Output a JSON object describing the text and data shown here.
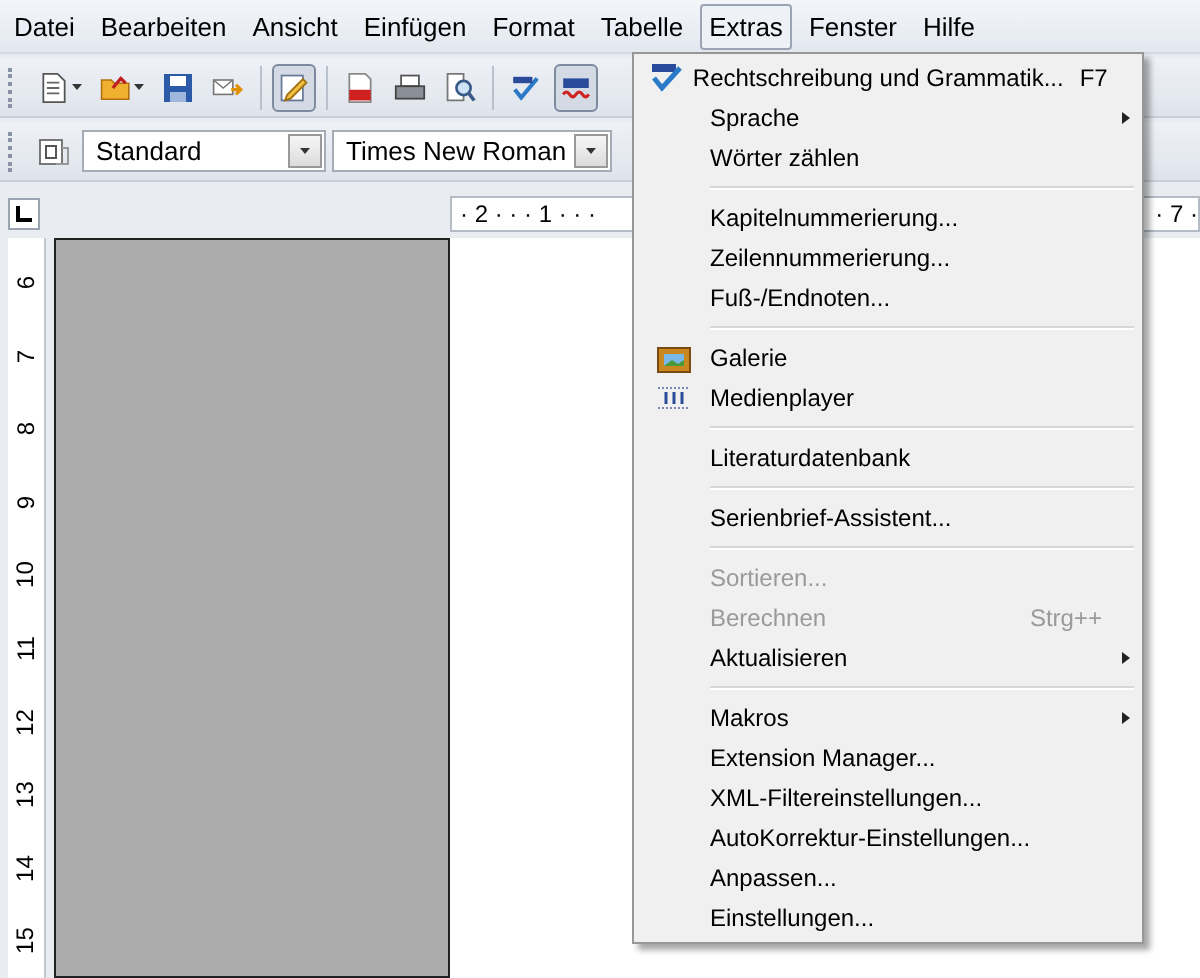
{
  "menubar": [
    {
      "label": "Datei",
      "selected": false
    },
    {
      "label": "Bearbeiten",
      "selected": false
    },
    {
      "label": "Ansicht",
      "selected": false
    },
    {
      "label": "Einfügen",
      "selected": false
    },
    {
      "label": "Format",
      "selected": false
    },
    {
      "label": "Tabelle",
      "selected": false
    },
    {
      "label": "Extras",
      "selected": true
    },
    {
      "label": "Fenster",
      "selected": false
    },
    {
      "label": "Hilfe",
      "selected": false
    }
  ],
  "standard_toolbar": [
    {
      "kind": "new",
      "dropdown": true,
      "selected": false
    },
    {
      "kind": "open",
      "dropdown": true,
      "selected": false
    },
    {
      "kind": "save",
      "dropdown": false,
      "selected": false
    },
    {
      "kind": "mail",
      "dropdown": false,
      "selected": false
    },
    {
      "kind": "separator"
    },
    {
      "kind": "edit",
      "dropdown": false,
      "selected": true
    },
    {
      "kind": "separator"
    },
    {
      "kind": "pdf",
      "dropdown": false,
      "selected": false
    },
    {
      "kind": "print",
      "dropdown": false,
      "selected": false
    },
    {
      "kind": "preview",
      "dropdown": false,
      "selected": false
    },
    {
      "kind": "separator"
    },
    {
      "kind": "spellcheck",
      "dropdown": false,
      "selected": false
    },
    {
      "kind": "autospell",
      "dropdown": false,
      "selected": true
    }
  ],
  "format_toolbar": {
    "style": "Standard",
    "font": "Times New Roman"
  },
  "horizontal_ruler": {
    "left": "· 2 · · · 1 · · ·",
    "right": "· 7 ·"
  },
  "vertical_ruler": [
    "6",
    "7",
    "8",
    "9",
    "10",
    "11",
    "12",
    "13",
    "14",
    "15"
  ],
  "extras_menu": [
    {
      "kind": "spellcheck",
      "label": "Rechtschreibung und Grammatik...",
      "shortcut": "F7",
      "submenu": false,
      "disabled": false
    },
    {
      "kind": "item",
      "label": "Sprache",
      "submenu": true,
      "disabled": false
    },
    {
      "kind": "item",
      "label": "Wörter zählen",
      "submenu": false,
      "disabled": false
    },
    {
      "kind": "separator"
    },
    {
      "kind": "item",
      "label": "Kapitelnummerierung...",
      "submenu": false,
      "disabled": false
    },
    {
      "kind": "item",
      "label": "Zeilennummerierung...",
      "submenu": false,
      "disabled": false
    },
    {
      "kind": "item",
      "label": "Fuß-/Endnoten...",
      "submenu": false,
      "disabled": false
    },
    {
      "kind": "separator"
    },
    {
      "kind": "gallery",
      "label": "Galerie",
      "submenu": false,
      "disabled": false
    },
    {
      "kind": "media",
      "label": "Medienplayer",
      "submenu": false,
      "disabled": false
    },
    {
      "kind": "separator"
    },
    {
      "kind": "item",
      "label": "Literaturdatenbank",
      "submenu": false,
      "disabled": false
    },
    {
      "kind": "separator"
    },
    {
      "kind": "item",
      "label": "Serienbrief-Assistent...",
      "submenu": false,
      "disabled": false
    },
    {
      "kind": "separator"
    },
    {
      "kind": "item",
      "label": "Sortieren...",
      "submenu": false,
      "disabled": true
    },
    {
      "kind": "item",
      "label": "Berechnen",
      "shortcut": "Strg++",
      "submenu": false,
      "disabled": true
    },
    {
      "kind": "item",
      "label": "Aktualisieren",
      "submenu": true,
      "disabled": false
    },
    {
      "kind": "separator"
    },
    {
      "kind": "item",
      "label": "Makros",
      "submenu": true,
      "disabled": false
    },
    {
      "kind": "item",
      "label": "Extension Manager...",
      "submenu": false,
      "disabled": false
    },
    {
      "kind": "item",
      "label": "XML-Filtereinstellungen...",
      "submenu": false,
      "disabled": false
    },
    {
      "kind": "item",
      "label": "AutoKorrektur-Einstellungen...",
      "submenu": false,
      "disabled": false
    },
    {
      "kind": "item",
      "label": "Anpassen...",
      "submenu": false,
      "disabled": false
    },
    {
      "kind": "item",
      "label": "Einstellungen...",
      "submenu": false,
      "disabled": false
    }
  ]
}
